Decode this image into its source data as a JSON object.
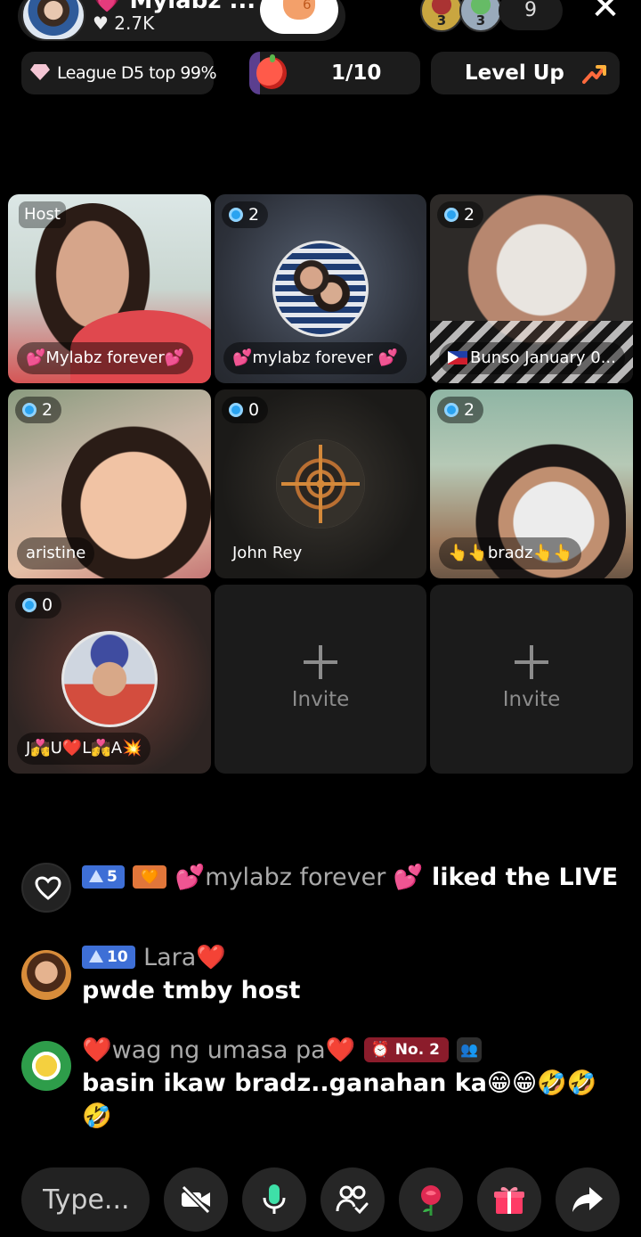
{
  "header": {
    "host_name": "Mylabz ...",
    "host_likes": "2.7K",
    "follow_count": "6",
    "viewer_badges": [
      "3",
      "3"
    ],
    "viewer_count": "9",
    "close_label": "✕"
  },
  "stats": {
    "league": "League D5 top 99%",
    "progress": "1/10",
    "level_up": "Level Up"
  },
  "grid": {
    "tiles": [
      {
        "tag": "Host",
        "name": "💕Mylabz forever💕"
      },
      {
        "count": "2",
        "name": "💕mylabz forever 💕"
      },
      {
        "count": "2",
        "name": "Bunso January 0..."
      },
      {
        "count": "2",
        "name": "aristine"
      },
      {
        "count": "0",
        "name": "John Rey"
      },
      {
        "count": "2",
        "name": "👆👆bradz👆👆"
      },
      {
        "count": "0",
        "name": "J💏U❤️L💏A💥"
      },
      {
        "invite": "Invite"
      },
      {
        "invite": "Invite"
      }
    ]
  },
  "chat": {
    "messages": [
      {
        "level": "5",
        "user": "💕mylabz forever 💕",
        "text": "liked the LIVE"
      },
      {
        "level": "10",
        "user": "Lara",
        "text": "pwde tmby host"
      },
      {
        "user": "wag ng umasa pa",
        "rank": "No. 2",
        "text": "basin ikaw bradz..ganahan ka😁😁🤣🤣🤣"
      }
    ]
  },
  "bottom": {
    "input_placeholder": "Type..."
  },
  "colors": {
    "background": "#000000",
    "level_badge": "#3e6fd6",
    "rank_badge": "#8b1c2b",
    "accent_pink": "#e2577f"
  }
}
